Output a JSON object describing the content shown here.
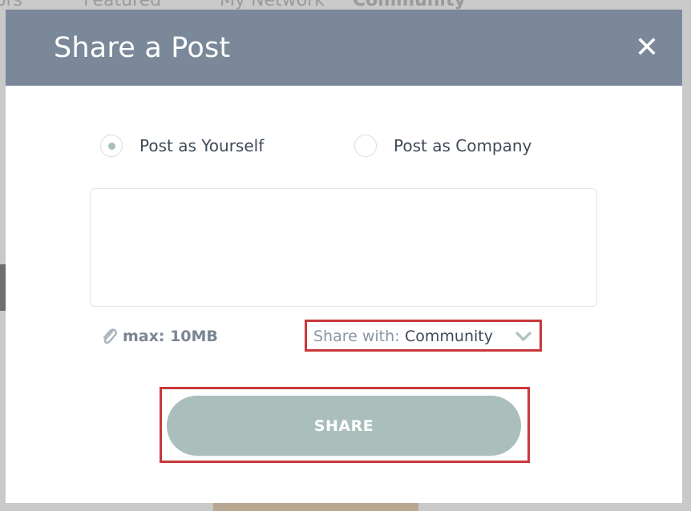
{
  "background": {
    "nav_items": [
      "ors",
      "Featured",
      "My Network",
      "Community"
    ]
  },
  "modal": {
    "title": "Share a Post",
    "close_symbol": "✕",
    "post_as": [
      {
        "label": "Post as Yourself",
        "checked": true
      },
      {
        "label": "Post as Company",
        "checked": false
      }
    ],
    "textarea": {
      "value": "",
      "placeholder": ""
    },
    "attachment": {
      "icon": "paperclip-icon",
      "label": "max: 10MB"
    },
    "share_with": {
      "prefix": "Share with:",
      "value": "Community",
      "icon": "chevron-down-icon"
    },
    "share_button": "SHARE"
  },
  "colors": {
    "header": "#7a8899",
    "button": "#aabfbc",
    "highlight_border": "#c9383a",
    "text_dark": "#3e4a57"
  }
}
